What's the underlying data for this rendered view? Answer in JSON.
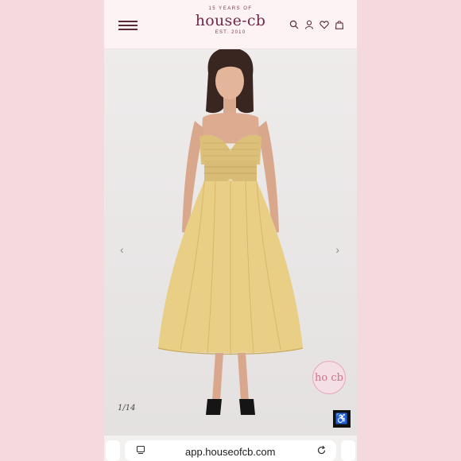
{
  "header": {
    "logo_top": "15 YEARS OF",
    "logo_main": "house-cb",
    "logo_est": "EST. 2010",
    "icons": [
      "menu-icon",
      "search-icon",
      "account-icon",
      "heart-icon",
      "bag-icon"
    ]
  },
  "gallery": {
    "counter": "1/14",
    "badge_text": "ho cb",
    "prev_arrow": "‹",
    "next_arrow": "›",
    "accessibility_glyph": "♿"
  },
  "browser": {
    "url": "app.houseofcb.com",
    "icons": [
      "tabs-icon",
      "reload-icon"
    ]
  },
  "colors": {
    "brand": "#6e2a45",
    "background": "#f4d9df",
    "dress": "#e9cf86"
  }
}
